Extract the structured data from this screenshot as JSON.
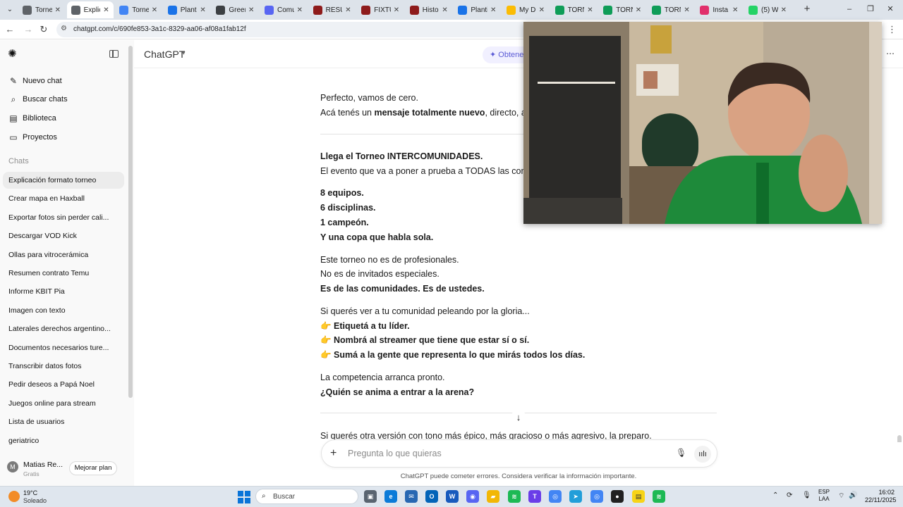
{
  "browser": {
    "tabs": [
      {
        "label": "Torne",
        "color": "#5f6368",
        "active": false
      },
      {
        "label": "Explic",
        "color": "#5f6368",
        "active": true
      },
      {
        "label": "Torne",
        "color": "#4285f4",
        "active": false
      },
      {
        "label": "Planti",
        "color": "#1a73e8",
        "active": false
      },
      {
        "label": "Green",
        "color": "#3c4043",
        "active": false
      },
      {
        "label": "Comu",
        "color": "#5865f2",
        "active": false
      },
      {
        "label": "RESUL",
        "color": "#8e1b1b",
        "active": false
      },
      {
        "label": "FIXTU",
        "color": "#8e1b1b",
        "active": false
      },
      {
        "label": "Histor",
        "color": "#8e1b1b",
        "active": false
      },
      {
        "label": "Planti",
        "color": "#1a73e8",
        "active": false
      },
      {
        "label": "My Di",
        "color": "#fbbc04",
        "active": false
      },
      {
        "label": "TORN",
        "color": "#0f9d58",
        "active": false
      },
      {
        "label": "TORN",
        "color": "#0f9d58",
        "active": false
      },
      {
        "label": "TORN",
        "color": "#0f9d58",
        "active": false
      },
      {
        "label": "Insta",
        "color": "#e1306c",
        "active": false
      },
      {
        "label": "(5) W",
        "color": "#25d366",
        "active": false
      }
    ],
    "url": "chatgpt.com/c/690fe853-3a1c-8329-aa06-af08a1fab12f"
  },
  "sidebar": {
    "actions": [
      {
        "icon": "✎",
        "label": "Nuevo chat"
      },
      {
        "icon": "⌕",
        "label": "Buscar chats"
      },
      {
        "icon": "▤",
        "label": "Biblioteca"
      },
      {
        "icon": "▭",
        "label": "Proyectos"
      }
    ],
    "section_label": "Chats",
    "chats": [
      "Explicación formato torneo",
      "Crear mapa en Haxball",
      "Exportar fotos sin perder cali...",
      "Descargar VOD Kick",
      "Ollas para vitrocerámica",
      "Resumen contrato Temu",
      "Informe KBIT Pia",
      "Imagen con texto",
      "Laterales derechos argentino...",
      "Documentos necesarios ture...",
      "Transcribir datos fotos",
      "Pedir deseos a Papá Noel",
      "Juegos online para stream",
      "Lista de usuarios",
      "geriatrico"
    ],
    "user": {
      "initial": "M",
      "name": "Matias Re...",
      "plan": "Gratis",
      "upgrade_label": "Mejorar plan"
    }
  },
  "header": {
    "model": "ChatGPT",
    "get_plus": "✦ Obtener"
  },
  "message": {
    "intro1": "Perfecto, vamos de cero.",
    "intro2_pre": "Acá tenés un ",
    "intro2_bold": "mensaje totalmente nuevo",
    "intro2_post": ", directo, atractivo",
    "title": "Llega el Torneo INTERCOMUNIDADES.",
    "subtitle": "El evento que va a poner a prueba a TODAS las comunidades",
    "stat1": "8 equipos.",
    "stat2": "6 disciplinas.",
    "stat3": "1 campeón.",
    "stat4": "Y una copa que habla sola.",
    "p1": "Este torneo no es de profesionales.",
    "p2": "No es de invitados especiales.",
    "p3": "Es de las comunidades. Es de ustedes.",
    "cta_intro": "Si querés ver a tu comunidad peleando por la gloria...",
    "emoji": "👉",
    "cta1": "Etiquetá a tu líder.",
    "cta2": "Nombrá al streamer que tiene que estar sí o sí.",
    "cta3": "Sumá a la gente que representa lo que mirás todos los días.",
    "close1": "La competencia arranca pronto.",
    "close2": "¿Quién se anima a entrar a la arena?",
    "followup": "Si querés otra versión con tono más épico, más gracioso o más agresivo, la preparo."
  },
  "composer": {
    "placeholder": "Pregunta lo que quieras",
    "disclaimer": "ChatGPT puede cometer errores. Considera verificar la información importante."
  },
  "taskbar": {
    "temp": "19°C",
    "weather": "Soleado",
    "search": "Buscar",
    "lang_top": "ESP",
    "lang_bottom": "LAA",
    "time": "16:02",
    "date": "22/11/2025"
  }
}
